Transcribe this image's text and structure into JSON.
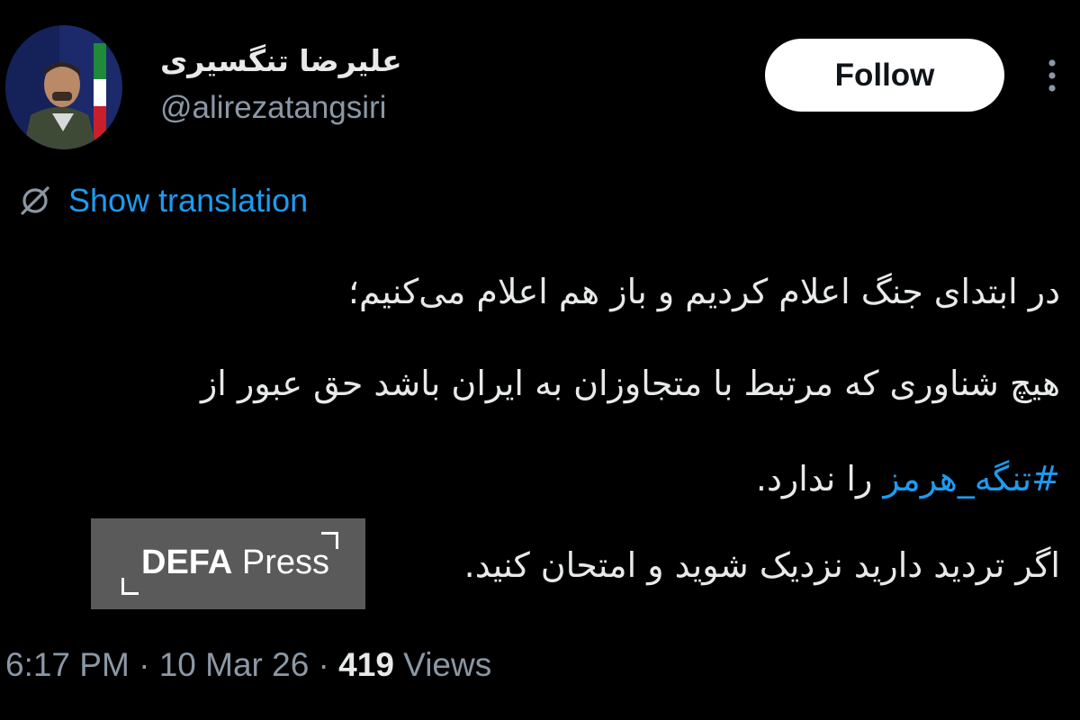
{
  "author": {
    "display_name": "علیرضا تنگسیری",
    "handle": "@alirezatangsiri"
  },
  "actions": {
    "follow_label": "Follow",
    "more_icon": "more-vertical-icon"
  },
  "translation": {
    "icon": "globe-off-icon",
    "label": "Show translation"
  },
  "tweet": {
    "line1": "در ابتدای جنگ اعلام کردیم و باز هم اعلام می‌کنیم؛",
    "line2": "هیچ شناوری که مرتبط با متجاوزان به ایران باشد حق عبور از",
    "hashtag": "#تنگه_هرمز",
    "line3_rest": " را ندارد.",
    "line4": "اگر تردید دارید نزدیک شوید و امتحان کنید."
  },
  "watermark": {
    "brand_bold": "DEFA",
    "brand_rest": " Press"
  },
  "meta": {
    "time": "6:17 PM",
    "separator": " · ",
    "date": "10 Mar 26",
    "views_count": "419",
    "views_label": " Views"
  },
  "colors": {
    "background": "#000000",
    "text_primary": "#e7e9ea",
    "text_secondary": "#8b98a5",
    "link": "#1d9bf0",
    "follow_bg": "#ffffff"
  }
}
